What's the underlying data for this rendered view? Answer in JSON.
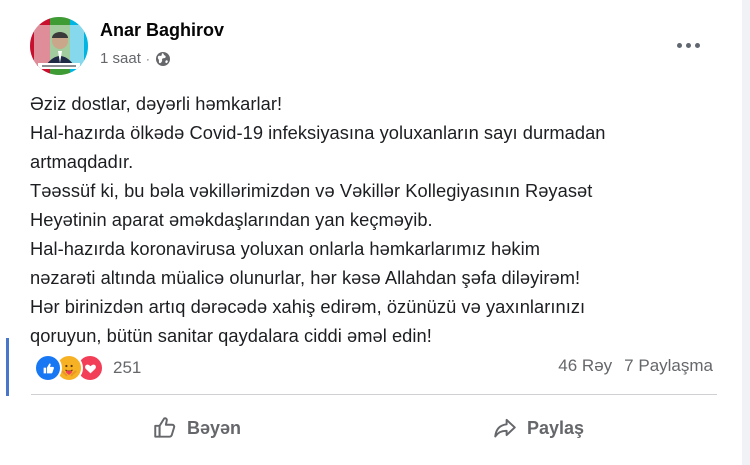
{
  "post": {
    "author": "Anar Baghirov",
    "time": "1 saat",
    "separator": "·",
    "privacy_icon": "globe-icon",
    "text_lines": [
      "Əziz dostlar, dəyərli həmkarlar!",
      "Hal-hazırda ölkədə Covid-19 infeksiyasına yoluxanların sayı durmadan",
      "artmaqdadır.",
      "Təəssüf ki, bu bəla vəkillərimizdən və Vəkillər Kollegiyasının Rəyasət",
      "Heyətinin aparat əməkdaşlarından yan keçməyib.",
      "Hal-hazırda  koronavirusa yoluxan onlarla həmkarlarımız həkim",
      "nəzarəti altında müalicə olunurlar, hər kəsə Allahdan şəfa diləyirəm!",
      "Hər birinizdən artıq dərəcədə xahiş edirəm,  özünüzü və yaxınlarınızı",
      "qoruyun, bütün sanitar qaydalara ciddi əməl edin!"
    ]
  },
  "reactions": {
    "icons": [
      "like-icon",
      "care-icon",
      "love-icon"
    ],
    "count": "251"
  },
  "stats": {
    "comments": "46 Rəy",
    "shares": "7 Paylaşma"
  },
  "actions": {
    "like_label": "Bəyən",
    "share_label": "Paylaş"
  },
  "colors": {
    "like_blue": "#1877f2",
    "care_yellow": "#f7b125",
    "love_red": "#f33e58",
    "secondary_text": "#65676b"
  }
}
